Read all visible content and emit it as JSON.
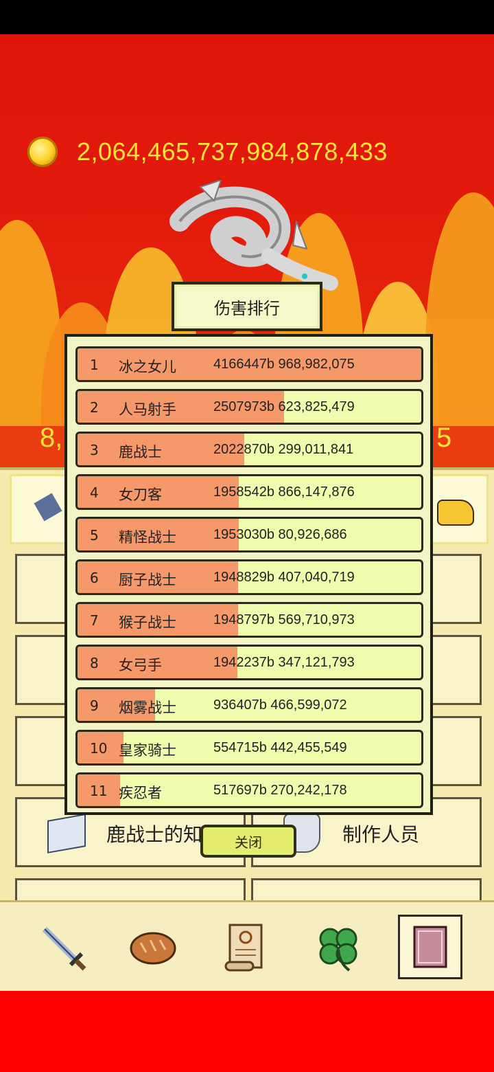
{
  "gold": {
    "amount": "2,064,465,737,984,878,433"
  },
  "side_numbers": {
    "left": "8,",
    "right": "5"
  },
  "dialog": {
    "title": "伤害排行",
    "close_label": "关闭",
    "rows": [
      {
        "rank": "1",
        "name": "冰之女儿",
        "value": "4166447b 968,982,075",
        "share": 1.0
      },
      {
        "rank": "2",
        "name": "人马射手",
        "value": "2507973b 623,825,479",
        "share": 0.6
      },
      {
        "rank": "3",
        "name": "鹿战士",
        "value": "2022870b 299,011,841",
        "share": 0.485
      },
      {
        "rank": "4",
        "name": "女刀客",
        "value": "1958542b 866,147,876",
        "share": 0.47
      },
      {
        "rank": "5",
        "name": "精怪战士",
        "value": "1953030b 80,926,686",
        "share": 0.469
      },
      {
        "rank": "6",
        "name": "厨子战士",
        "value": "1948829b 407,040,719",
        "share": 0.468
      },
      {
        "rank": "7",
        "name": "猴子战士",
        "value": "1948797b 569,710,973",
        "share": 0.468
      },
      {
        "rank": "8",
        "name": "女弓手",
        "value": "1942237b 347,121,793",
        "share": 0.466
      },
      {
        "rank": "9",
        "name": "烟雾战士",
        "value": "936407b 466,599,072",
        "share": 0.225
      },
      {
        "rank": "10",
        "name": "皇家骑士",
        "value": "554715b 442,455,549",
        "share": 0.133
      },
      {
        "rank": "11",
        "name": "疾忍者",
        "value": "517697b 270,242,178",
        "share": 0.124
      }
    ]
  },
  "background_menu": {
    "left_label": "鹿战士的知识",
    "right_label": "制作人员"
  },
  "bottom_nav": [
    {
      "icon": "sword-icon"
    },
    {
      "icon": "bread-icon"
    },
    {
      "icon": "scroll-icon"
    },
    {
      "icon": "clover-icon"
    },
    {
      "icon": "book-icon",
      "active": true
    }
  ],
  "colors": {
    "background_red": "#e51b0c",
    "gold_text": "#ffe53a",
    "bar_orange": "#f5986a",
    "row_fill": "#f1fbae"
  }
}
